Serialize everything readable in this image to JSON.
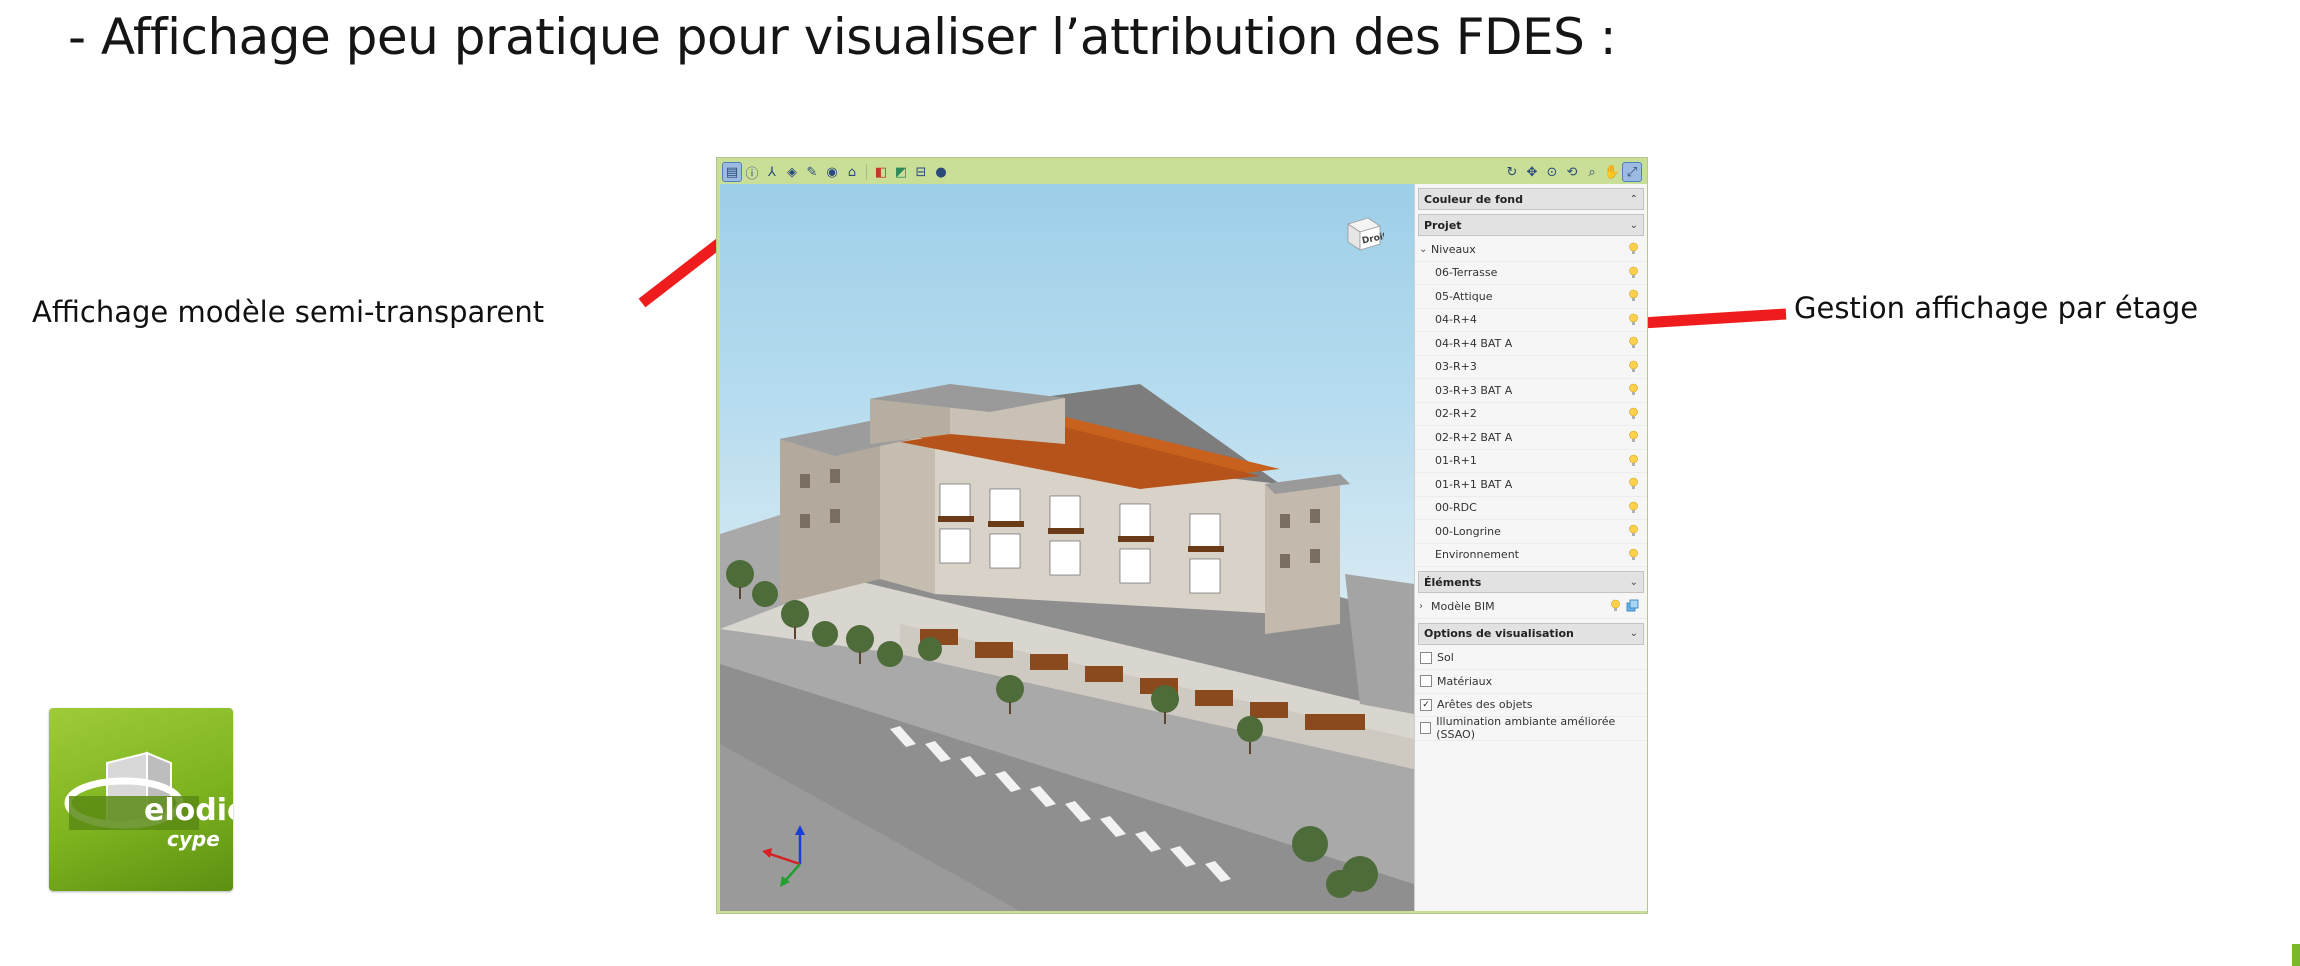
{
  "slide": {
    "title": "-  Affichage peu pratique pour visualiser l’attribution des FDES :",
    "annotation_left": "Affichage modèle semi-transparent",
    "annotation_right": "Gestion affichage par étage"
  },
  "toolbar": {
    "left_icons": [
      "layers-icon",
      "info-icon",
      "axis-icon",
      "shield-icon",
      "paint-icon",
      "eye-group-icon",
      "home-level-icon",
      "section-icon",
      "clip-icon",
      "split-icon",
      "visibility-icon"
    ],
    "right_icons": [
      "orbit-icon",
      "pan-cube-icon",
      "zoom-extent-icon",
      "walk-icon",
      "zoom-icon",
      "hand-icon",
      "fit-icon"
    ]
  },
  "viewcube": {
    "face": "Droite"
  },
  "panel": {
    "background_section": "Couleur de fond",
    "project_section": "Projet",
    "levels_group": "Niveaux",
    "levels": [
      "06-Terrasse",
      "05-Attique",
      "04-R+4",
      "04-R+4 BAT A",
      "03-R+3",
      "03-R+3 BAT A",
      "02-R+2",
      "02-R+2 BAT A",
      "01-R+1",
      "01-R+1 BAT A",
      "00-RDC",
      "00-Longrine",
      "Environnement"
    ],
    "elements_section": "Éléments",
    "bim_model": "Modèle BIM",
    "options_section": "Options de visualisation",
    "options": [
      {
        "label": "Sol",
        "checked": false
      },
      {
        "label": "Matériaux",
        "checked": false
      },
      {
        "label": "Arêtes des objets",
        "checked": true
      },
      {
        "label": "Illumination ambiante améliorée (SSAO)",
        "checked": false
      }
    ]
  },
  "logo": {
    "line1": "elodie",
    "line2": "cype"
  },
  "colors": {
    "arrow": "#ee1c1c",
    "window_frame": "#c9de97",
    "logo_green": "#7db31f",
    "roof_orange": "#c8601e"
  }
}
